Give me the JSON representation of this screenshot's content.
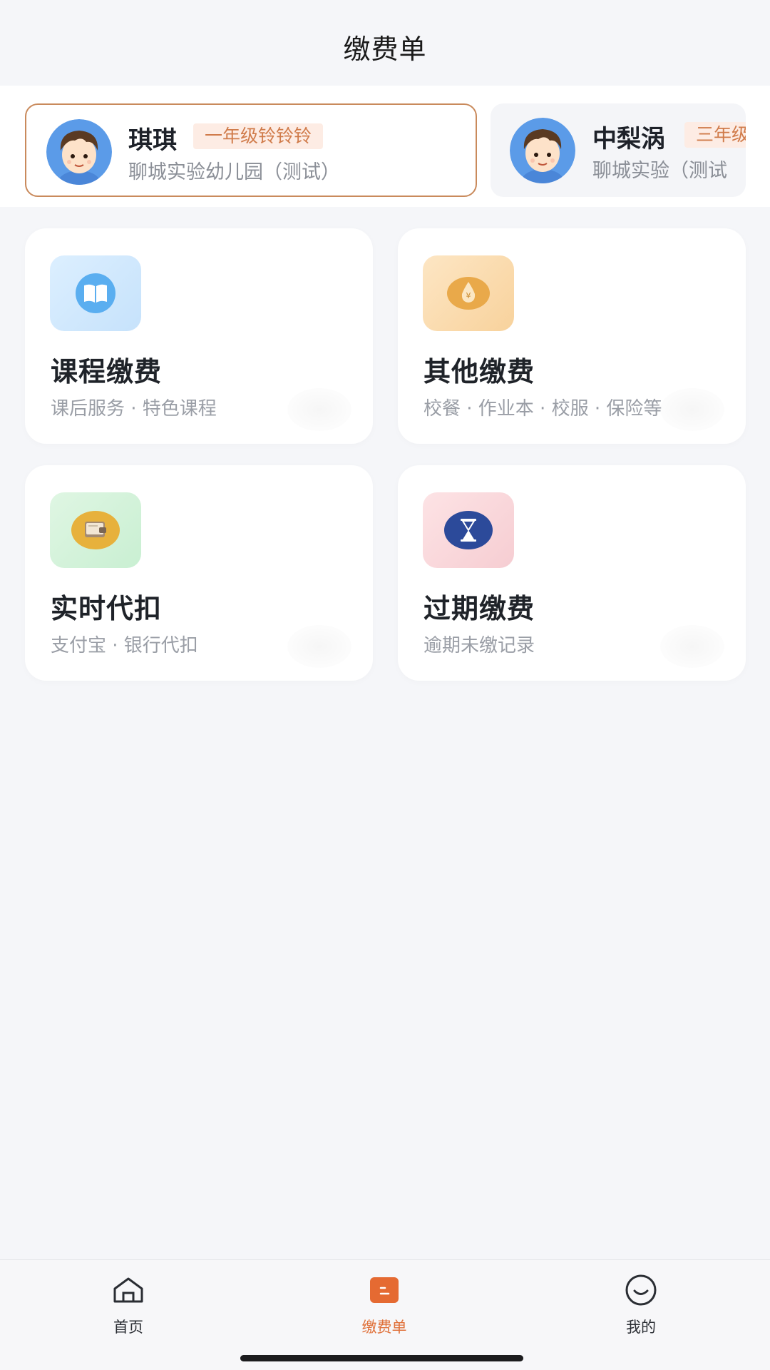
{
  "header": {
    "title": "缴费单"
  },
  "students": [
    {
      "name": "琪琪",
      "grade": "一年级铃铃铃",
      "school": "聊城实验幼儿园（测试）",
      "active": true
    },
    {
      "name": "中梨涡",
      "grade": "三年级",
      "school": "聊城实验（测试",
      "active": false
    }
  ],
  "cards": [
    {
      "title": "课程缴费",
      "subtitle": "课后服务 · 特色课程",
      "icon": "book-icon",
      "color": "#5aaef0"
    },
    {
      "title": "其他缴费",
      "subtitle": "校餐 · 作业本 · 校服 · 保险等",
      "icon": "money-bag-icon",
      "color": "#f0b25a"
    },
    {
      "title": "实时代扣",
      "subtitle": "支付宝 · 银行代扣",
      "icon": "wallet-icon",
      "color": "#e7b13c"
    },
    {
      "title": "过期缴费",
      "subtitle": "逾期未缴记录",
      "icon": "hourglass-icon",
      "color": "#2c4a9a"
    }
  ],
  "tabs": [
    {
      "label": "首页",
      "icon": "home-icon",
      "active": false
    },
    {
      "label": "缴费单",
      "icon": "bill-icon",
      "active": true
    },
    {
      "label": "我的",
      "icon": "smile-face-icon",
      "active": false
    }
  ],
  "colors": {
    "accent": "#e0713a",
    "tag_bg": "#fdece4",
    "tag_text": "#d07b4a",
    "active_border": "#c98a5c"
  }
}
